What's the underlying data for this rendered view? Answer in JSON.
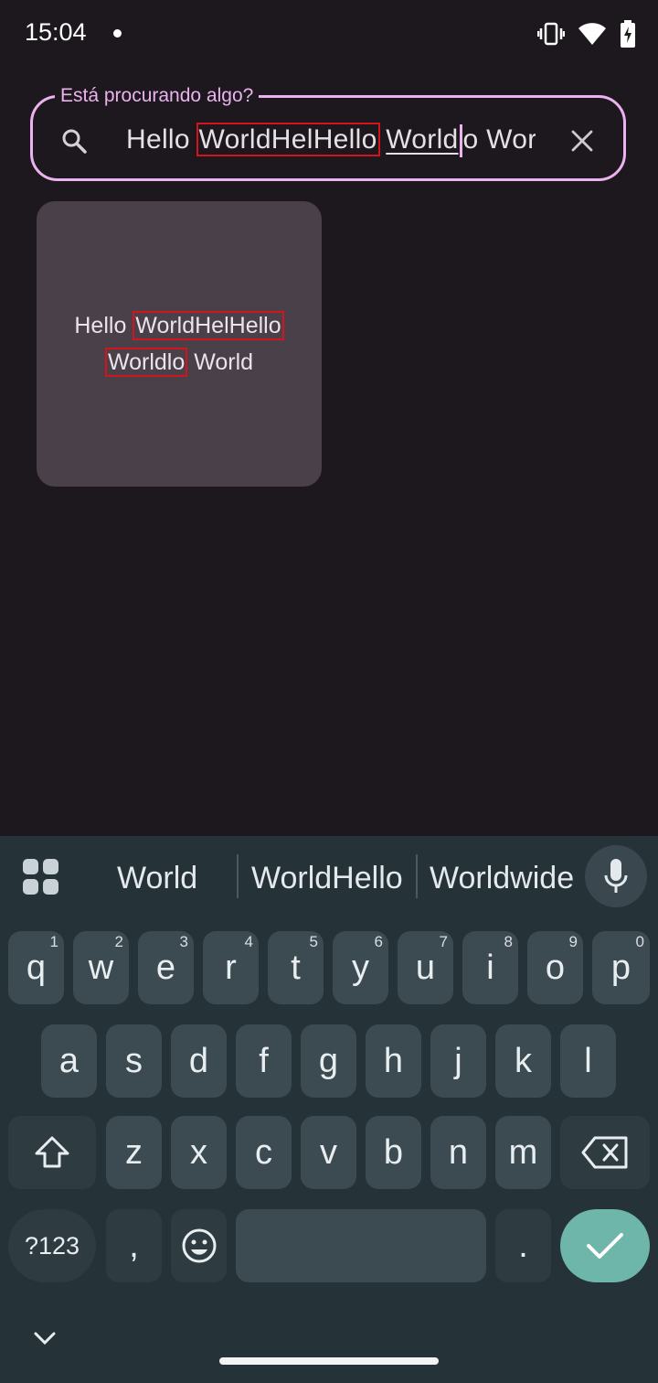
{
  "status_bar": {
    "time": "15:04"
  },
  "search": {
    "label": "Está procurando algo?",
    "text_plain_1": "Hello ",
    "text_boxed": "WorldHelHello",
    "text_plain_2": " ",
    "text_underlined": "World",
    "text_plain_3": "o World"
  },
  "result_card": {
    "plain_1": "Hello ",
    "boxed_1": "WorldHelHello",
    "boxed_2": "Worldlo",
    "plain_2": " World"
  },
  "keyboard": {
    "suggestions": [
      "World",
      "WorldHello",
      "Worldwide"
    ],
    "row1": [
      {
        "k": "q",
        "n": "1"
      },
      {
        "k": "w",
        "n": "2"
      },
      {
        "k": "e",
        "n": "3"
      },
      {
        "k": "r",
        "n": "4"
      },
      {
        "k": "t",
        "n": "5"
      },
      {
        "k": "y",
        "n": "6"
      },
      {
        "k": "u",
        "n": "7"
      },
      {
        "k": "i",
        "n": "8"
      },
      {
        "k": "o",
        "n": "9"
      },
      {
        "k": "p",
        "n": "0"
      }
    ],
    "row2": [
      "a",
      "s",
      "d",
      "f",
      "g",
      "h",
      "j",
      "k",
      "l"
    ],
    "row3": [
      "z",
      "x",
      "c",
      "v",
      "b",
      "n",
      "m"
    ],
    "symbols_label": "?123",
    "comma": ",",
    "period": "."
  }
}
